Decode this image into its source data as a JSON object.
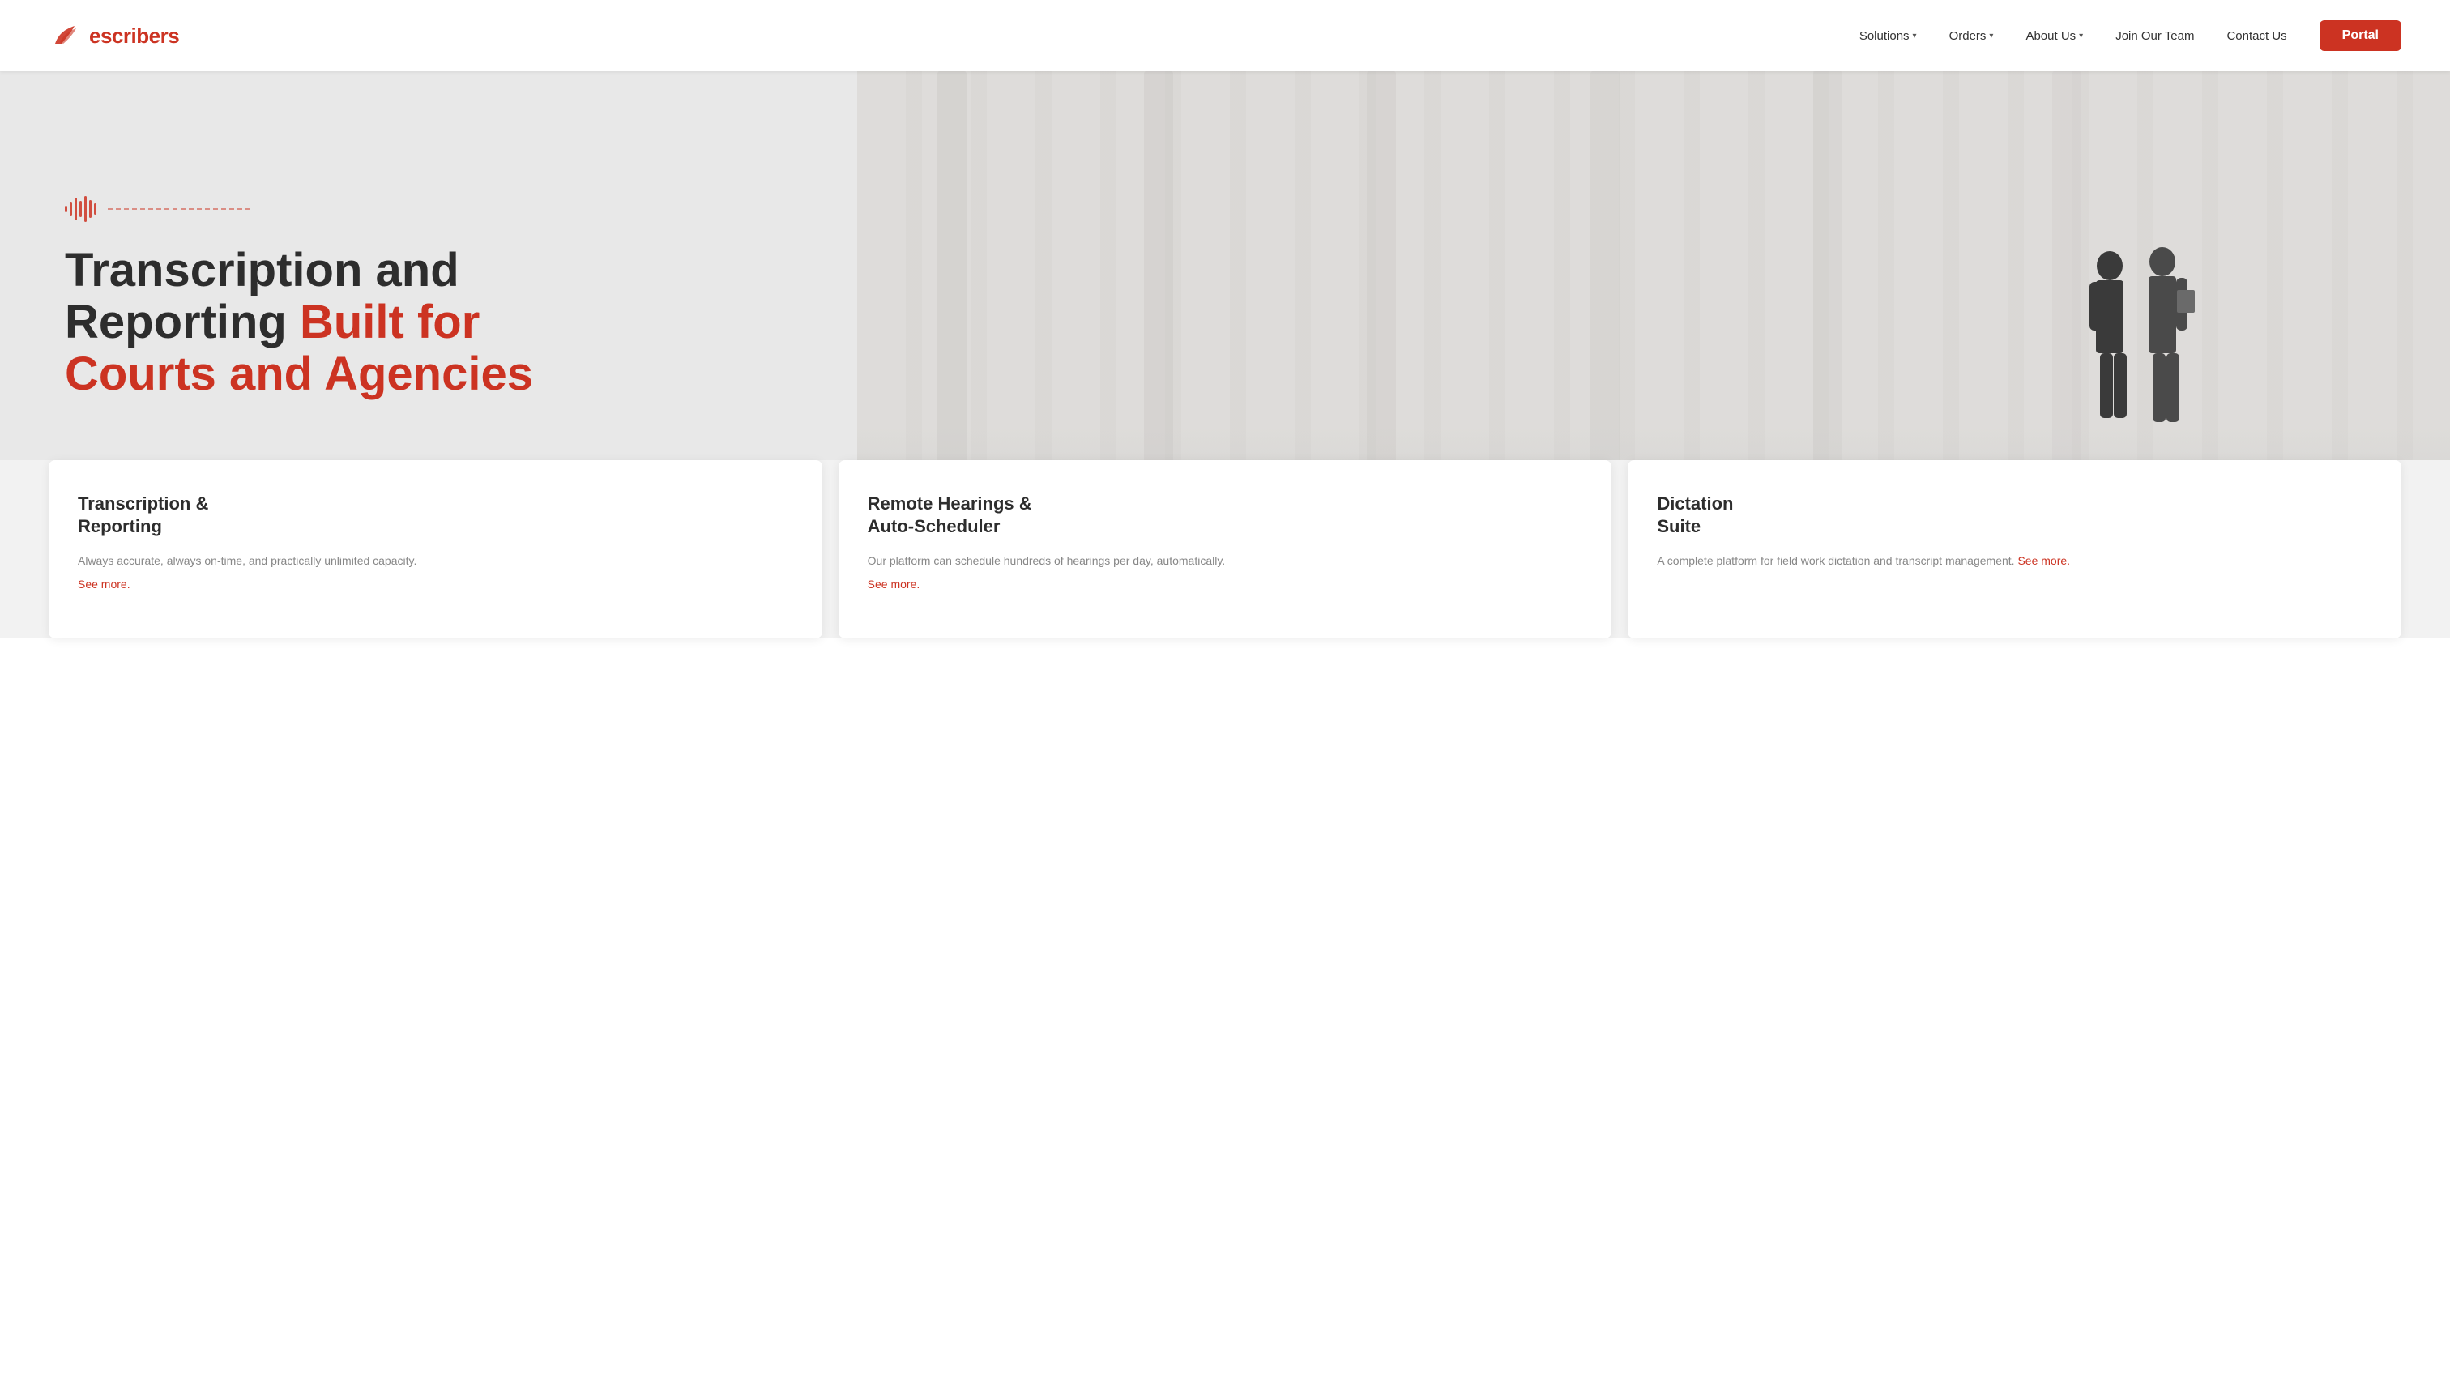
{
  "brand": {
    "logo_prefix": "e",
    "logo_suffix": "scribers",
    "logo_alt": "eScribers logo"
  },
  "navbar": {
    "links": [
      {
        "label": "Solutions",
        "has_dropdown": true
      },
      {
        "label": "Orders",
        "has_dropdown": true
      },
      {
        "label": "About Us",
        "has_dropdown": true
      },
      {
        "label": "Join Our Team",
        "has_dropdown": false
      },
      {
        "label": "Contact Us",
        "has_dropdown": false
      }
    ],
    "portal_label": "Portal"
  },
  "hero": {
    "heading_line1": "Transcription and",
    "heading_line2": "Reporting ",
    "heading_accent1": "Built for",
    "heading_line3": "Courts and Agencies"
  },
  "cards": [
    {
      "title": "Transcription &\nReporting",
      "description": "Always accurate, always on-time, and practically unlimited capacity.",
      "link": "See more."
    },
    {
      "title": "Remote Hearings &\nAuto-Scheduler",
      "description": "Our platform can schedule hundreds of hearings per day, automatically.",
      "link": "See more."
    },
    {
      "title": "Dictation\nSuite",
      "description": "A complete platform for field work dictation and transcript management.",
      "link": "See more."
    }
  ],
  "colors": {
    "accent": "#cc3322",
    "dark_text": "#2d2d2d",
    "muted_text": "#888888"
  }
}
